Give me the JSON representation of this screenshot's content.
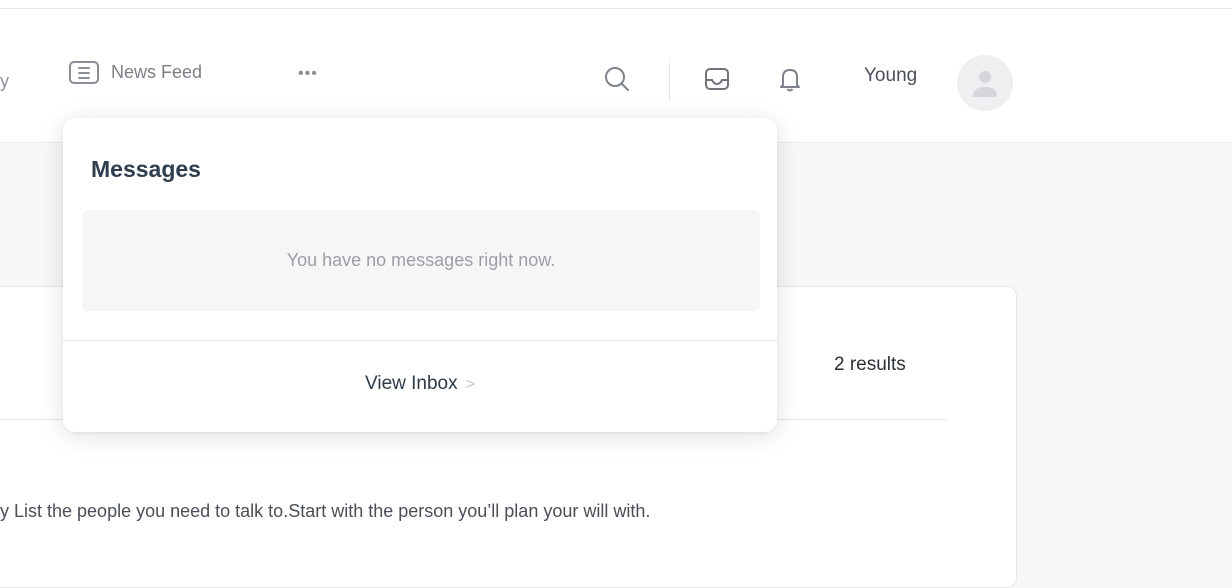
{
  "nav": {
    "clipped_item": "y",
    "news_feed_label": "News Feed",
    "more_label": "•••",
    "user_name": "Young"
  },
  "icons": {
    "news_feed": "news-feed-icon",
    "search": "search-icon",
    "inbox": "inbox-icon",
    "notifications": "bell-icon",
    "avatar": "user-avatar-icon",
    "chevron": "chevron-right-icon"
  },
  "messages_popover": {
    "title": "Messages",
    "empty_text": "You have no messages right now.",
    "view_inbox_label": "View Inbox",
    "chevron": ">"
  },
  "content": {
    "results_count": "2 results",
    "body_text": "y List the people you need to talk to.Start with the person you’ll plan your will with."
  },
  "colors": {
    "annotation_mark": "#dd1f1f",
    "title": "#2f3d4e",
    "muted": "#9b9fa5"
  }
}
